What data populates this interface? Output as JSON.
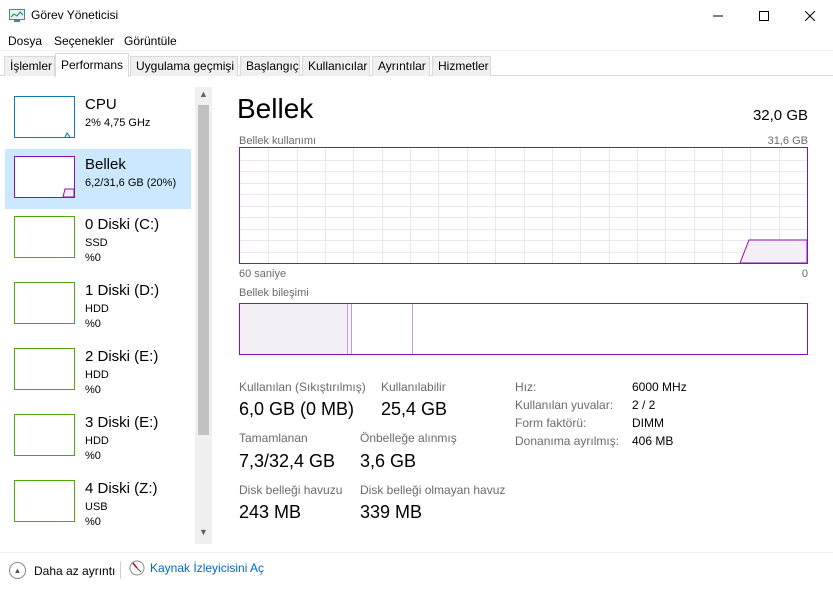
{
  "window": {
    "title": "Görev Yöneticisi"
  },
  "menu": {
    "items": [
      "Dosya",
      "Seçenekler",
      "Görüntüle"
    ]
  },
  "tabs": [
    {
      "label": "İşlemler",
      "active": false
    },
    {
      "label": "Performans",
      "active": true
    },
    {
      "label": "Uygulama geçmişi",
      "active": false
    },
    {
      "label": "Başlangıç",
      "active": false
    },
    {
      "label": "Kullanıcılar",
      "active": false
    },
    {
      "label": "Ayrıntılar",
      "active": false
    },
    {
      "label": "Hizmetler",
      "active": false
    }
  ],
  "sidebar": {
    "items": [
      {
        "title": "CPU",
        "line1": "2%  4,75 GHz",
        "line2": "",
        "selected": false,
        "kind": "cpu"
      },
      {
        "title": "Bellek",
        "line1": "6,2/31,6 GB (20%)",
        "line2": "",
        "selected": true,
        "kind": "mem"
      },
      {
        "title": "0 Diski (C:)",
        "line1": "SSD",
        "line2": "%0",
        "selected": false,
        "kind": "disk"
      },
      {
        "title": "1 Diski (D:)",
        "line1": "HDD",
        "line2": "%0",
        "selected": false,
        "kind": "disk"
      },
      {
        "title": "2 Diski (E:)",
        "line1": "HDD",
        "line2": "%0",
        "selected": false,
        "kind": "disk"
      },
      {
        "title": "3 Diski (E:)",
        "line1": "HDD",
        "line2": "%0",
        "selected": false,
        "kind": "disk"
      },
      {
        "title": "4 Diski (Z:)",
        "line1": "USB",
        "line2": "%0",
        "selected": false,
        "kind": "disk"
      }
    ]
  },
  "main": {
    "title": "Bellek",
    "total": "32,0 GB",
    "usage_label": "Bellek kullanımı",
    "usage_max": "31,6 GB",
    "axis_left": "60 saniye",
    "axis_right": "0",
    "composition_label": "Bellek bileşimi",
    "stats": {
      "in_use_label": "Kullanılan (Sıkıştırılmış)",
      "in_use_value": "6,0 GB (0 MB)",
      "available_label": "Kullanılabilir",
      "available_value": "25,4 GB",
      "committed_label": "Tamamlanan",
      "committed_value": "7,3/32,4 GB",
      "cached_label": "Önbelleğe alınmış",
      "cached_value": "3,6 GB",
      "paged_label": "Disk belleği havuzu",
      "paged_value": "243 MB",
      "nonpaged_label": "Disk belleği olmayan havuz",
      "nonpaged_value": "339 MB"
    },
    "specs": [
      {
        "label": "Hız:",
        "value": "6000 MHz"
      },
      {
        "label": "Kullanılan yuvalar:",
        "value": "2 / 2"
      },
      {
        "label": "Form faktörü:",
        "value": "DIMM"
      },
      {
        "label": "Donanıma ayrılmış:",
        "value": "406 MB"
      }
    ]
  },
  "footer": {
    "less_label": "Daha az ayrıntı",
    "resmon_label": "Kaynak İzleyicisini Aç"
  },
  "colors": {
    "memory": "#8b12ae",
    "cpu": "#1179b6",
    "disk": "#4da60c",
    "selected": "#cce8ff",
    "link": "#0066cc"
  }
}
